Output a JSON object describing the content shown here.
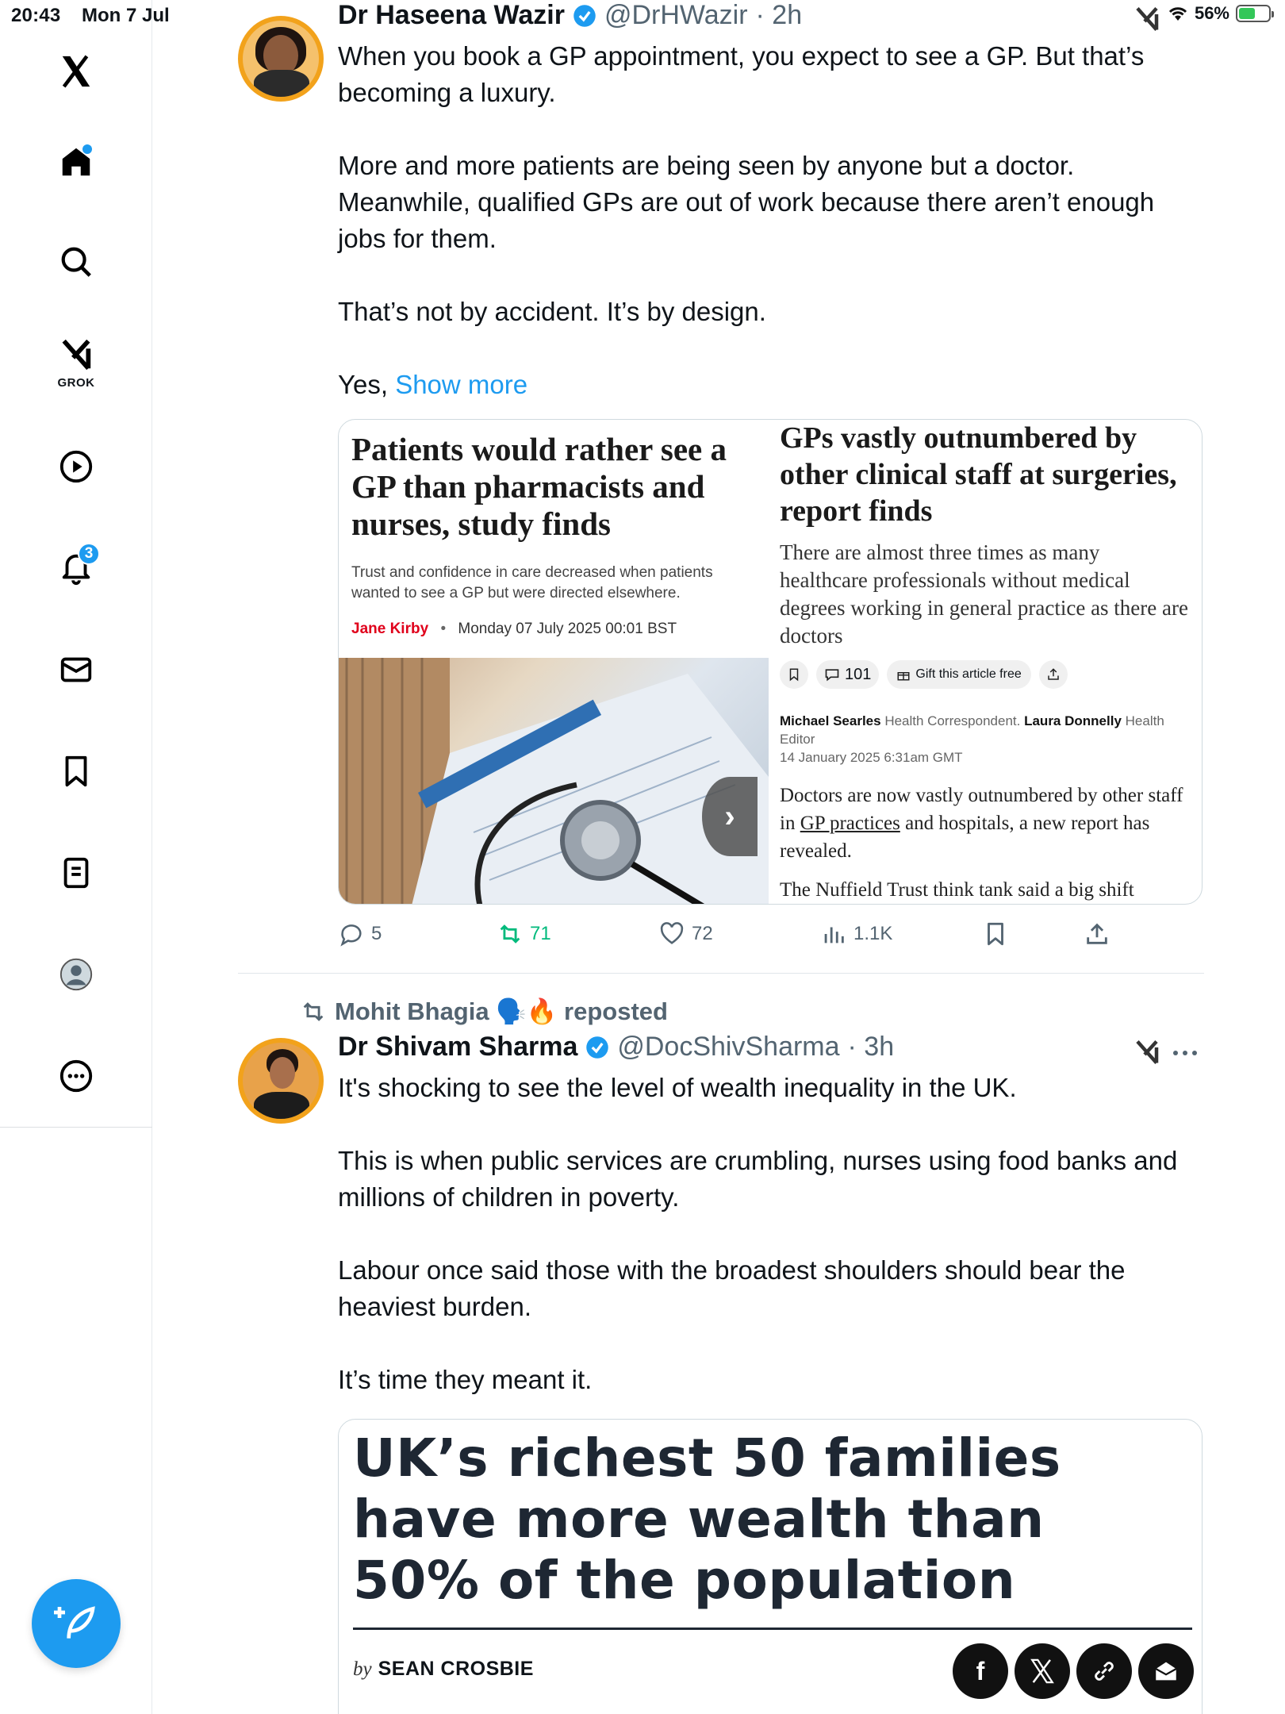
{
  "status": {
    "time": "20:43",
    "date": "Mon 7 Jul",
    "battery": "56%"
  },
  "sidebar": {
    "grok_label": "GROK",
    "notifications_badge": "3"
  },
  "post1": {
    "name": "Dr Haseena Wazir",
    "handle": "@DrHWazir",
    "time": "· 2h",
    "paragraphs": [
      "When you book a GP appointment, you expect to see a GP. But that’s becoming a luxury.",
      "More and more patients are being seen by anyone but a doctor. Meanwhile, qualified GPs are out of work because there aren’t enough jobs for them.",
      "That’s not by accident. It’s by design."
    ],
    "last_line": "Yes,",
    "show_more": "Show more",
    "card": {
      "left_headline": "Patients would rather see a GP than pharmacists and nurses, study finds",
      "left_sub": "Trust and confidence in care decreased when patients wanted to see a GP but were directed elsewhere.",
      "left_author": "Jane Kirby",
      "left_date": "Monday 07 July 2025 00:01 BST",
      "right_headline": "GPs vastly outnumbered by other clinical staff at surgeries, report finds",
      "right_sub": "There are almost three times as many healthcare professionals without medical degrees working in general practice as there are doctors",
      "right_comments": "101",
      "right_gift": "Gift this article free",
      "right_author1": "Michael Searles",
      "right_role1": "Health Correspondent.",
      "right_author2": "Laura Donnelly",
      "right_role2": "Health Editor",
      "right_date": "14 January 2025 6:31am GMT",
      "right_body_pre": "Doctors are now vastly outnumbered by other staff in ",
      "right_body_link": "GP practices",
      "right_body_post": " and hospitals, a new report has revealed.",
      "right_body2": "The Nuffield Trust think tank said a big shift"
    },
    "actions": {
      "replies": "5",
      "reposts": "71",
      "likes": "72",
      "views": "1.1K"
    }
  },
  "post2": {
    "reposter": "Mohit Bhagia 🗣️🔥 reposted",
    "name": "Dr Shivam Sharma",
    "handle": "@DocShivSharma",
    "time": "· 3h",
    "paragraphs": [
      "It's shocking to see the level of wealth inequality in the UK.",
      "This is when public services are crumbling, nurses using food banks and millions of children in poverty.",
      "Labour once said those with the broadest shoulders should bear the heaviest burden.",
      "It’s time they meant it."
    ],
    "card": {
      "headline": "UK’s richest 50 families have more wealth than 50% of the population",
      "by": "by",
      "author": "SEAN CROSBIE"
    }
  }
}
